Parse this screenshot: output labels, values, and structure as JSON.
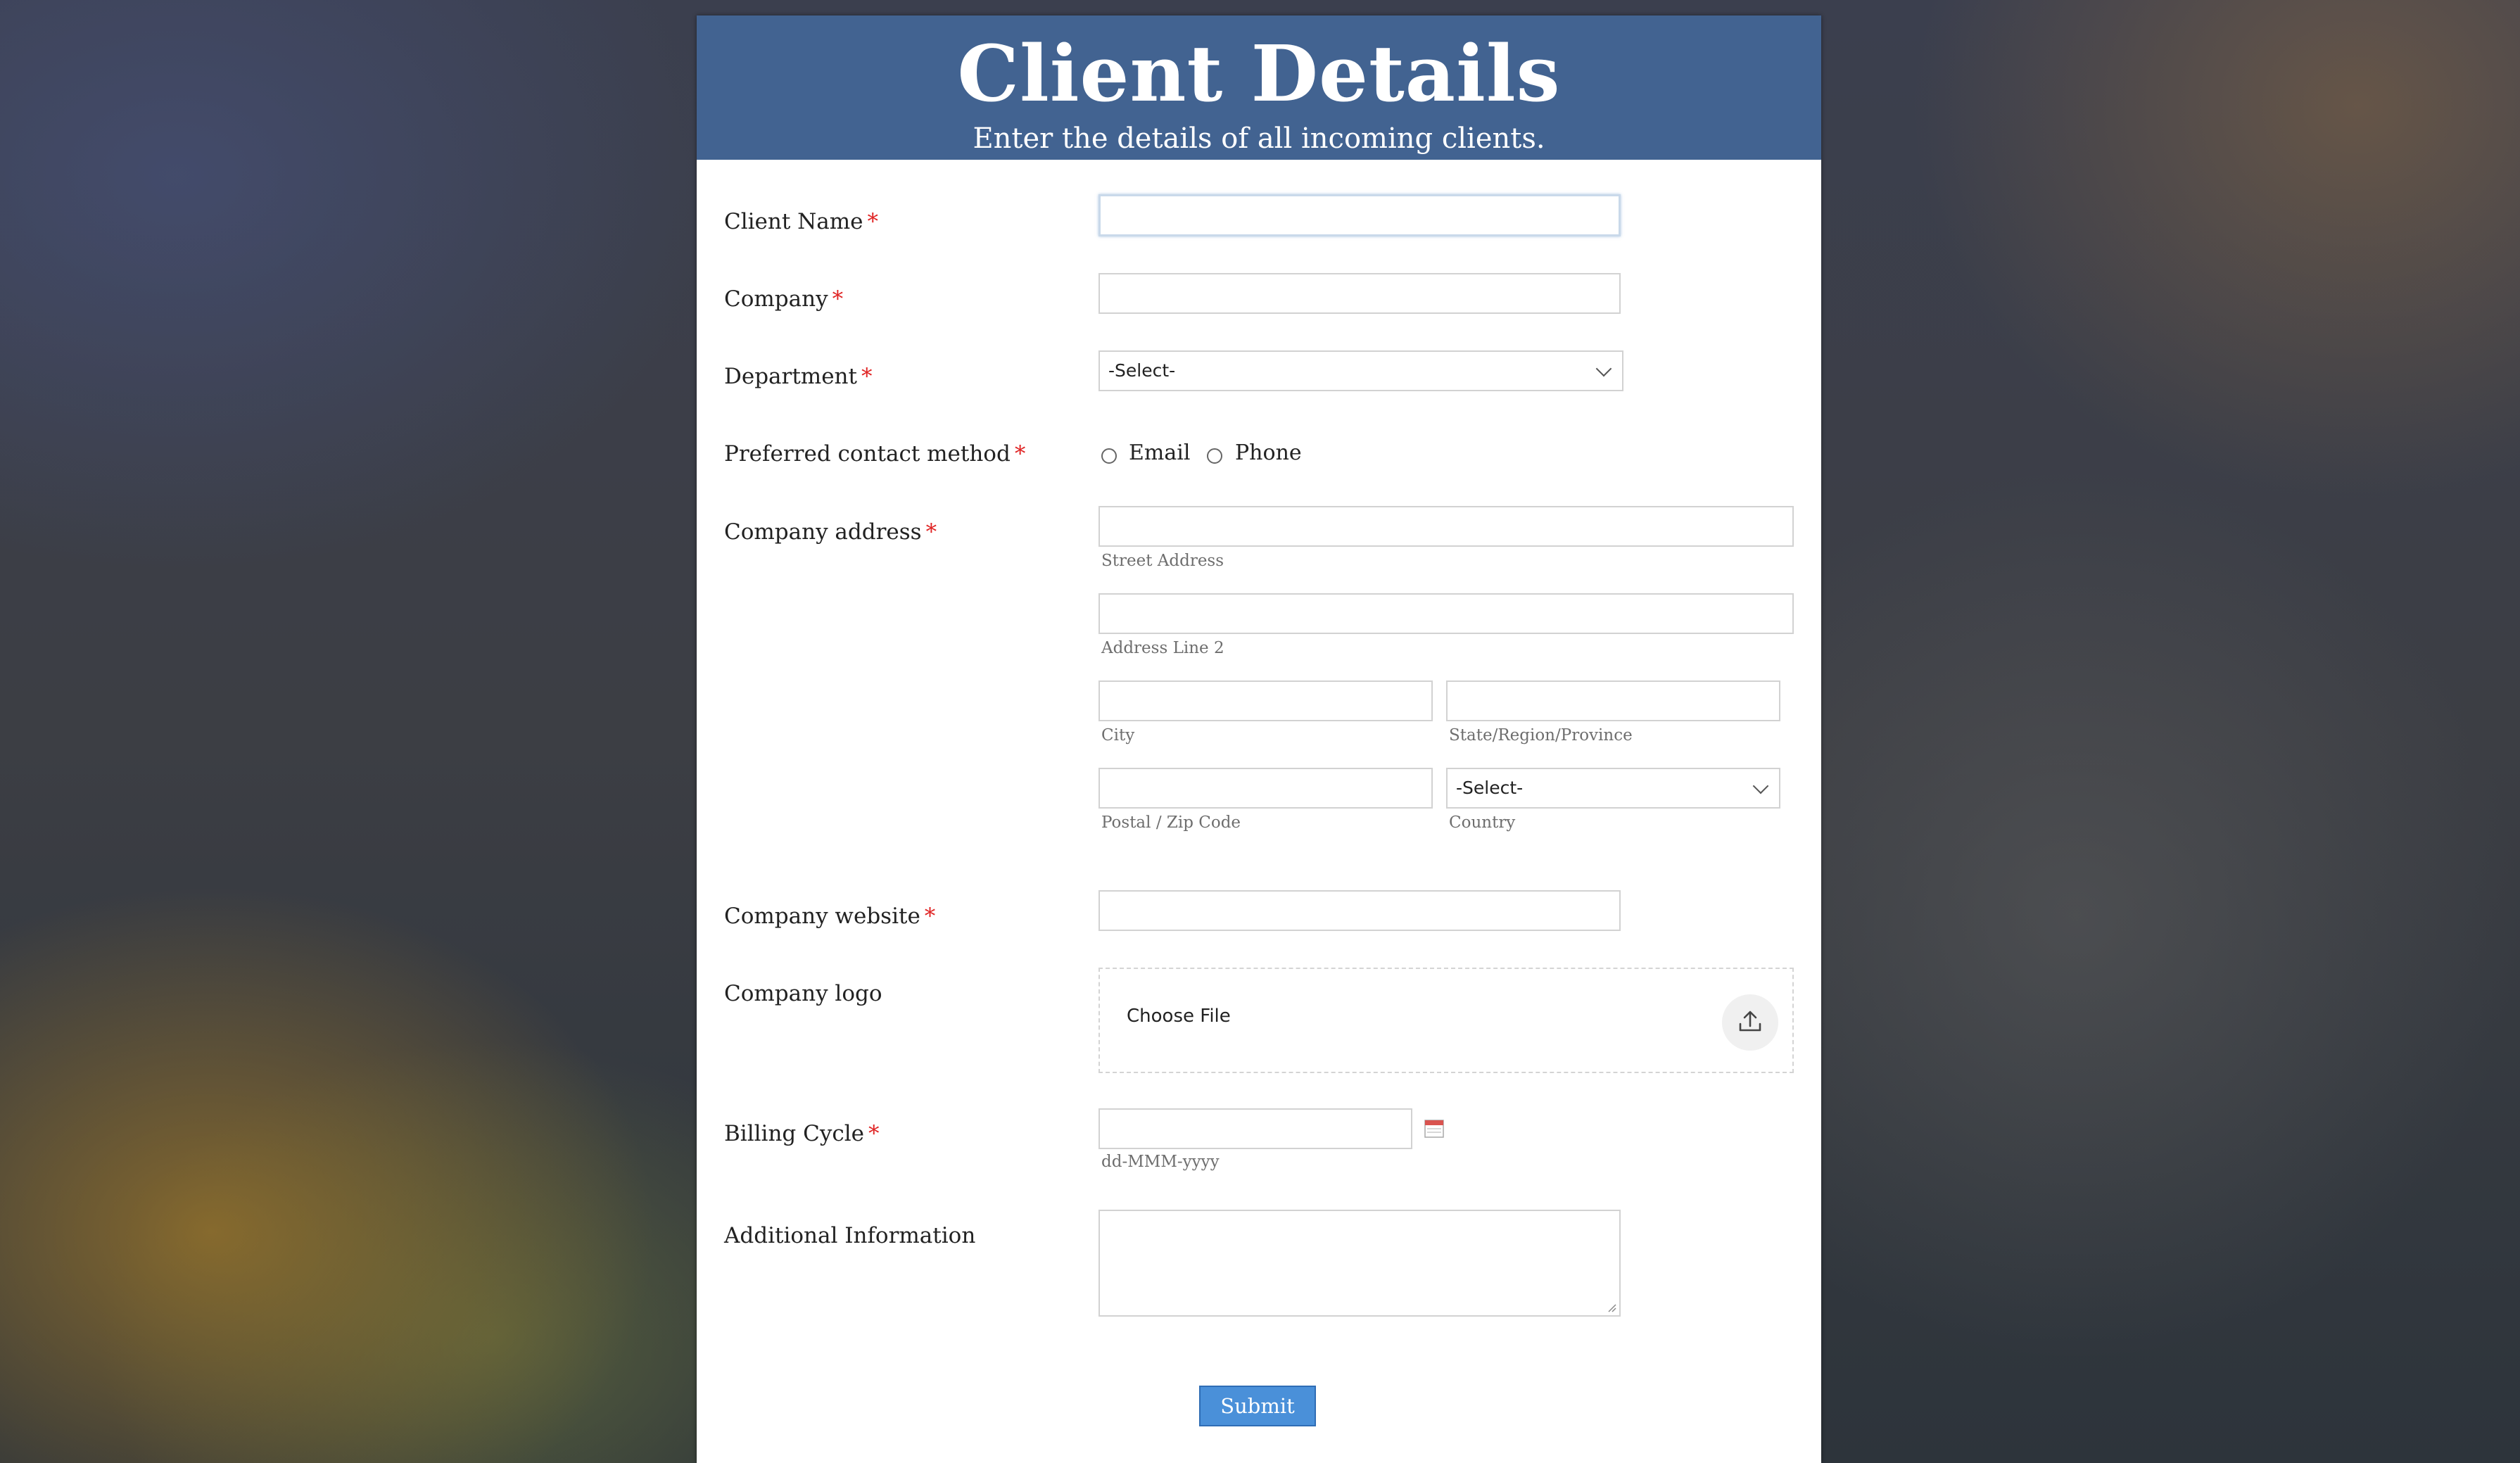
{
  "header": {
    "title": "Client Details",
    "subtitle": "Enter the details of all incoming clients."
  },
  "fields": {
    "client_name": {
      "label": "Client Name",
      "value": ""
    },
    "company": {
      "label": "Company",
      "value": ""
    },
    "department": {
      "label": "Department",
      "selected": "-Select-"
    },
    "contact_method": {
      "label": "Preferred contact method",
      "options": [
        "Email",
        "Phone"
      ],
      "selected": null
    },
    "address": {
      "label": "Company address",
      "street_label": "Street Address",
      "line2_label": "Address Line 2",
      "city_label": "City",
      "state_label": "State/Region/Province",
      "postal_label": "Postal / Zip Code",
      "country_label": "Country",
      "country_selected": "-Select-"
    },
    "website": {
      "label": "Company website",
      "value": ""
    },
    "logo": {
      "label": "Company logo",
      "choose_label": "Choose File"
    },
    "billing": {
      "label": "Billing Cycle",
      "format_hint": "dd-MMM-yyyy",
      "value": ""
    },
    "additional": {
      "label": "Additional Information",
      "value": ""
    }
  },
  "required_marker": "*",
  "submit_label": "Submit",
  "colors": {
    "header_bg": "#426391",
    "required": "#e02424",
    "submit_bg": "#4a90d9"
  },
  "icons": {
    "dropdown": "chevron-down-icon",
    "upload": "upload-icon",
    "calendar": "calendar-icon"
  }
}
